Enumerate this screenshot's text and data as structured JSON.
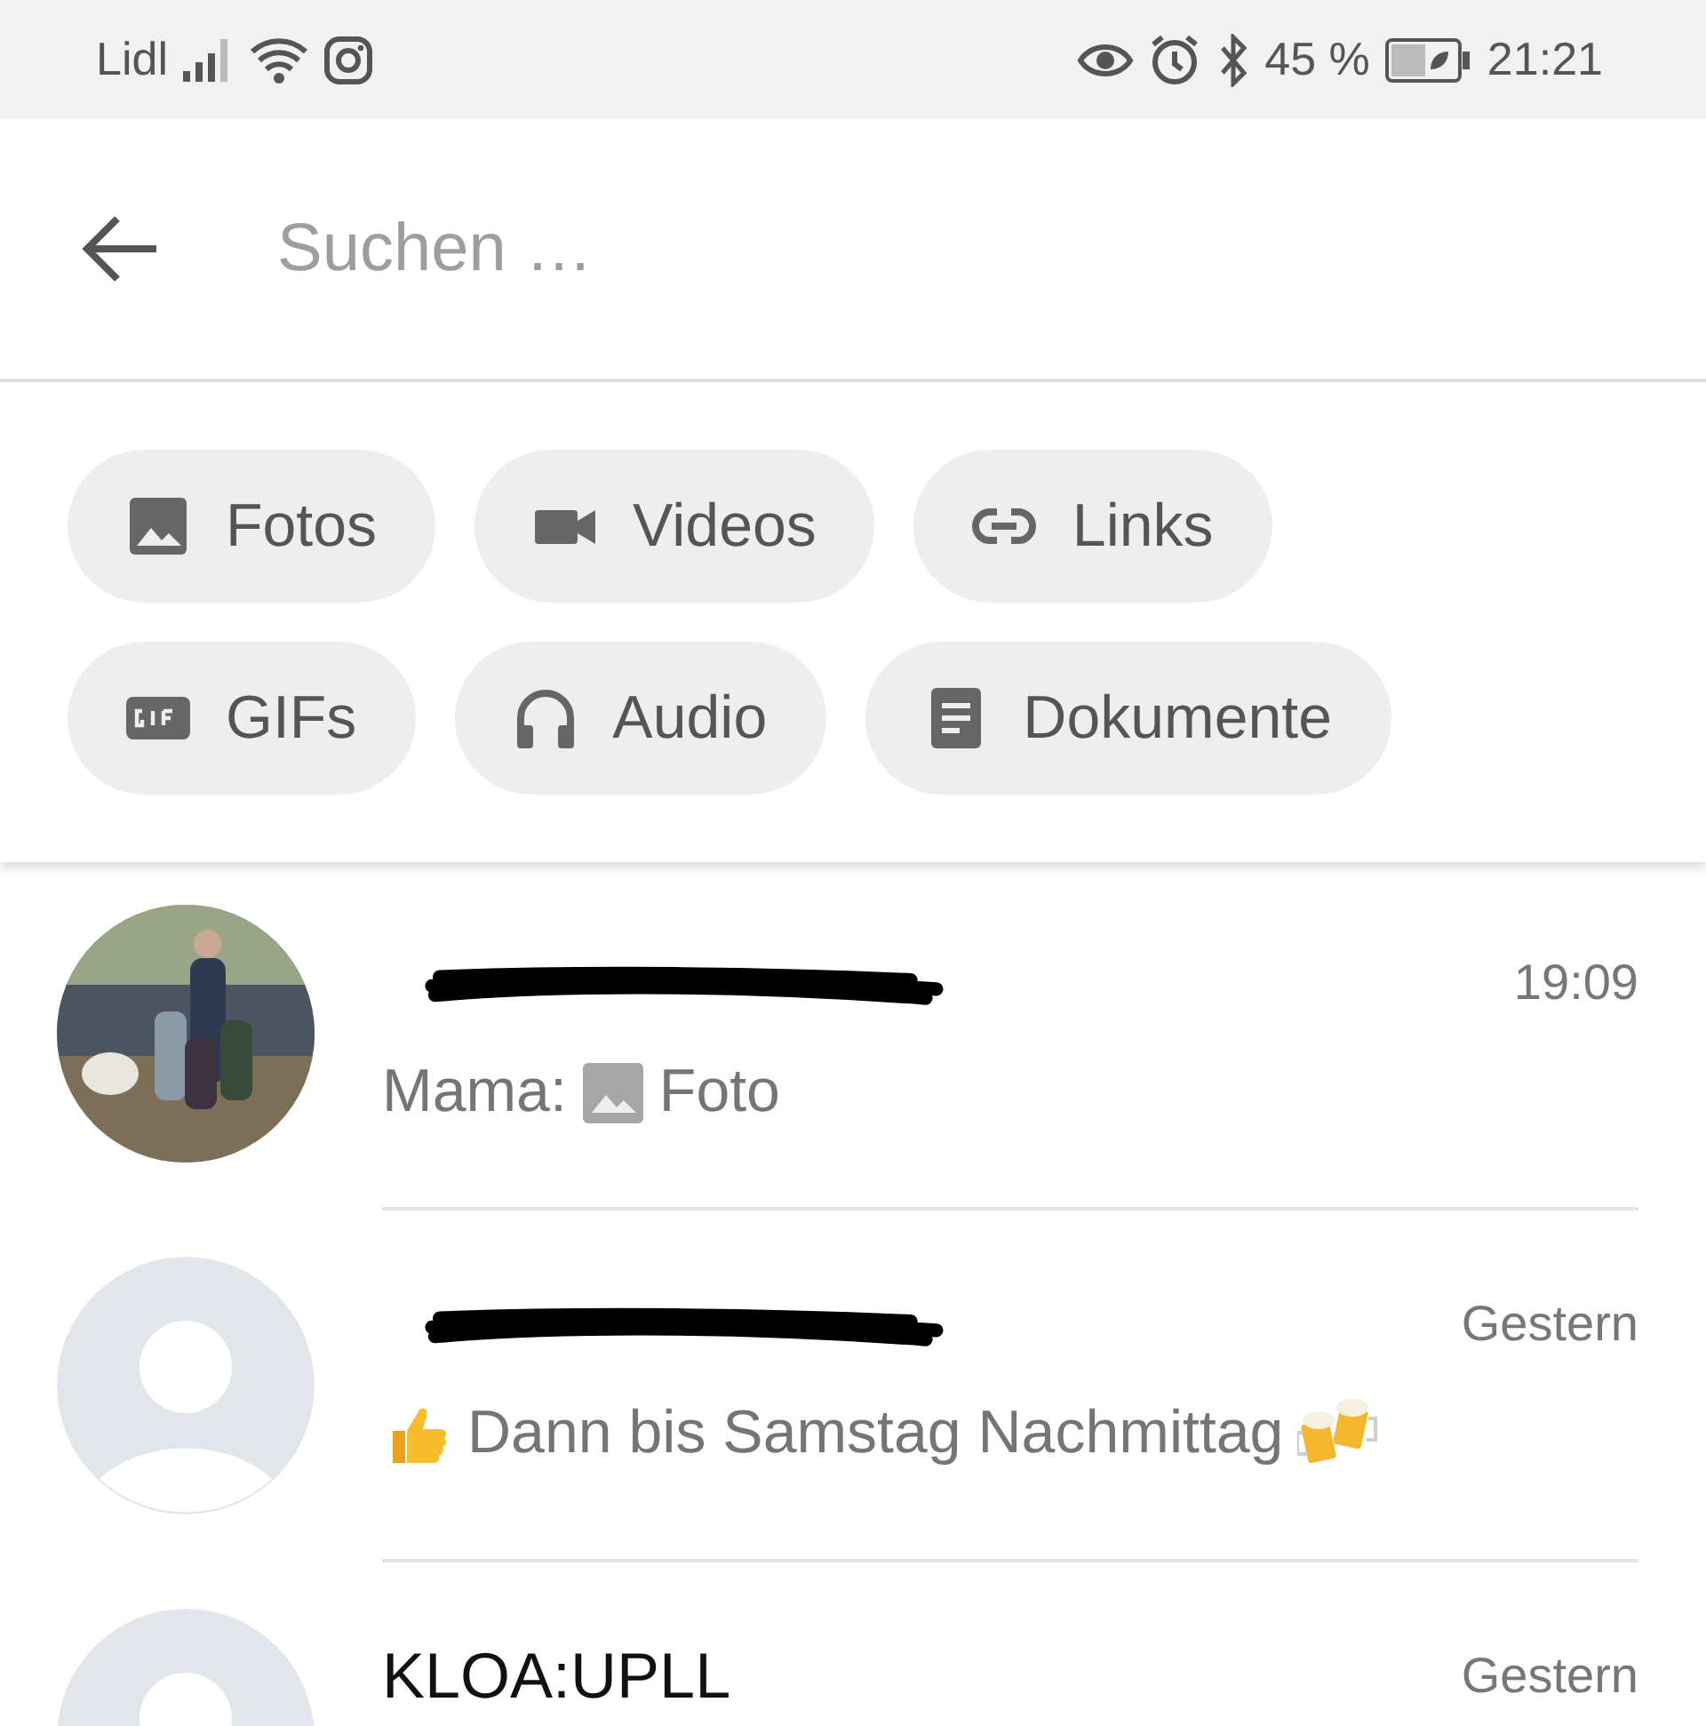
{
  "status_bar": {
    "carrier": "Lidl",
    "battery": "45 %",
    "time": "21:21"
  },
  "search": {
    "placeholder": "Suchen …"
  },
  "filters": [
    {
      "label": "Fotos"
    },
    {
      "kind": "video",
      "label": "Videos"
    },
    {
      "kind": "link",
      "label": "Links"
    },
    {
      "kind": "gif",
      "label": "GIFs"
    },
    {
      "kind": "audio",
      "label": "Audio"
    },
    {
      "kind": "document",
      "label": "Dokumente"
    }
  ],
  "chats": [
    {
      "name_redacted": true,
      "time": "19:09",
      "sender": "Mama:",
      "preview": "Foto"
    },
    {
      "avatar": {
        "kind": "placeholder"
      },
      "name_redacted": true,
      "time": "Gestern",
      "kind": "emoji",
      "preview": "Dann bis Samstag Nachmittag"
    },
    {
      "avatar": {
        "kind": "placeholder"
      },
      "name_redacted": false,
      "name": "KLOA:UPLL",
      "time": "Gestern",
      "kind": "text"
    }
  ]
}
